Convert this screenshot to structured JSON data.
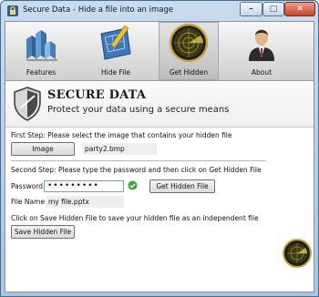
{
  "window": {
    "title": "Secure Data - Hide a file into an image"
  },
  "toolbar": {
    "items": [
      {
        "label": "Features"
      },
      {
        "label": "Hide File"
      },
      {
        "label": "Get Hidden"
      },
      {
        "label": "About"
      }
    ]
  },
  "banner": {
    "title": "SECURE DATA",
    "subtitle": "Protect your data using a secure means"
  },
  "step1": {
    "instruction": "First Step: Please select the image that contains your hidden file",
    "image_button": "Image",
    "image_value": "party2.bmp"
  },
  "step2": {
    "instruction": "Second Step: Please type the password and then click on Get Hidden File",
    "password_label": "Password",
    "password_value": "•••••••••",
    "get_button": "Get Hidden File",
    "filename_label": "File Name",
    "filename_value": "my file.pptx"
  },
  "step3": {
    "instruction": "Click on Save Hidden File to save your hidden file as an independent file",
    "save_button": "Save Hidden File"
  },
  "colors": {
    "accent": "#4a6a8e",
    "valid_check": "#3aa53a"
  },
  "icons": [
    "app-lock-icon",
    "minimize-icon",
    "maximize-icon",
    "close-icon",
    "buildings-chart-icon",
    "blueprint-icon",
    "radar-icon",
    "businessman-icon",
    "shield-icon",
    "checkmark-icon",
    "radar-badge-icon"
  ]
}
